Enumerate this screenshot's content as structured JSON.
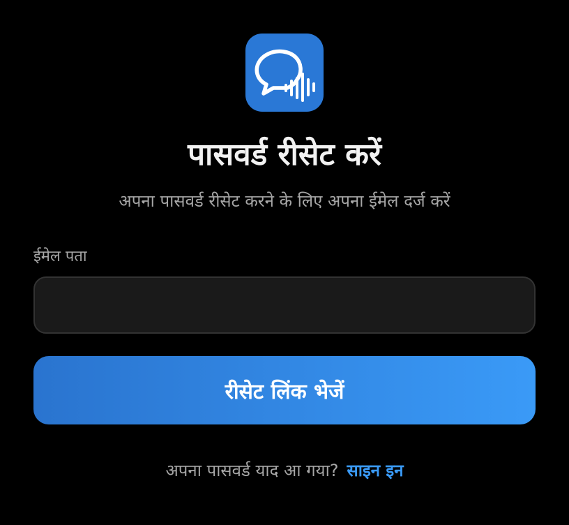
{
  "app": {
    "logo_icon": "chat-bubble-soundwave-icon",
    "logo_bg_color": "#2a78d6"
  },
  "header": {
    "title": "पासवर्ड रीसेट करें",
    "subtitle": "अपना पासवर्ड रीसेट करने के लिए अपना ईमेल दर्ज करें"
  },
  "form": {
    "email_label": "ईमेल पता",
    "email_value": "",
    "email_placeholder": "",
    "submit_label": "रीसेट लिंक भेजें",
    "submit_gradient": [
      "#2a74cf",
      "#3a9af7"
    ]
  },
  "footer": {
    "prompt": "अपना पासवर्ड याद आ गया?",
    "signin_label": "साइन इन",
    "link_color": "#3a9af7"
  }
}
